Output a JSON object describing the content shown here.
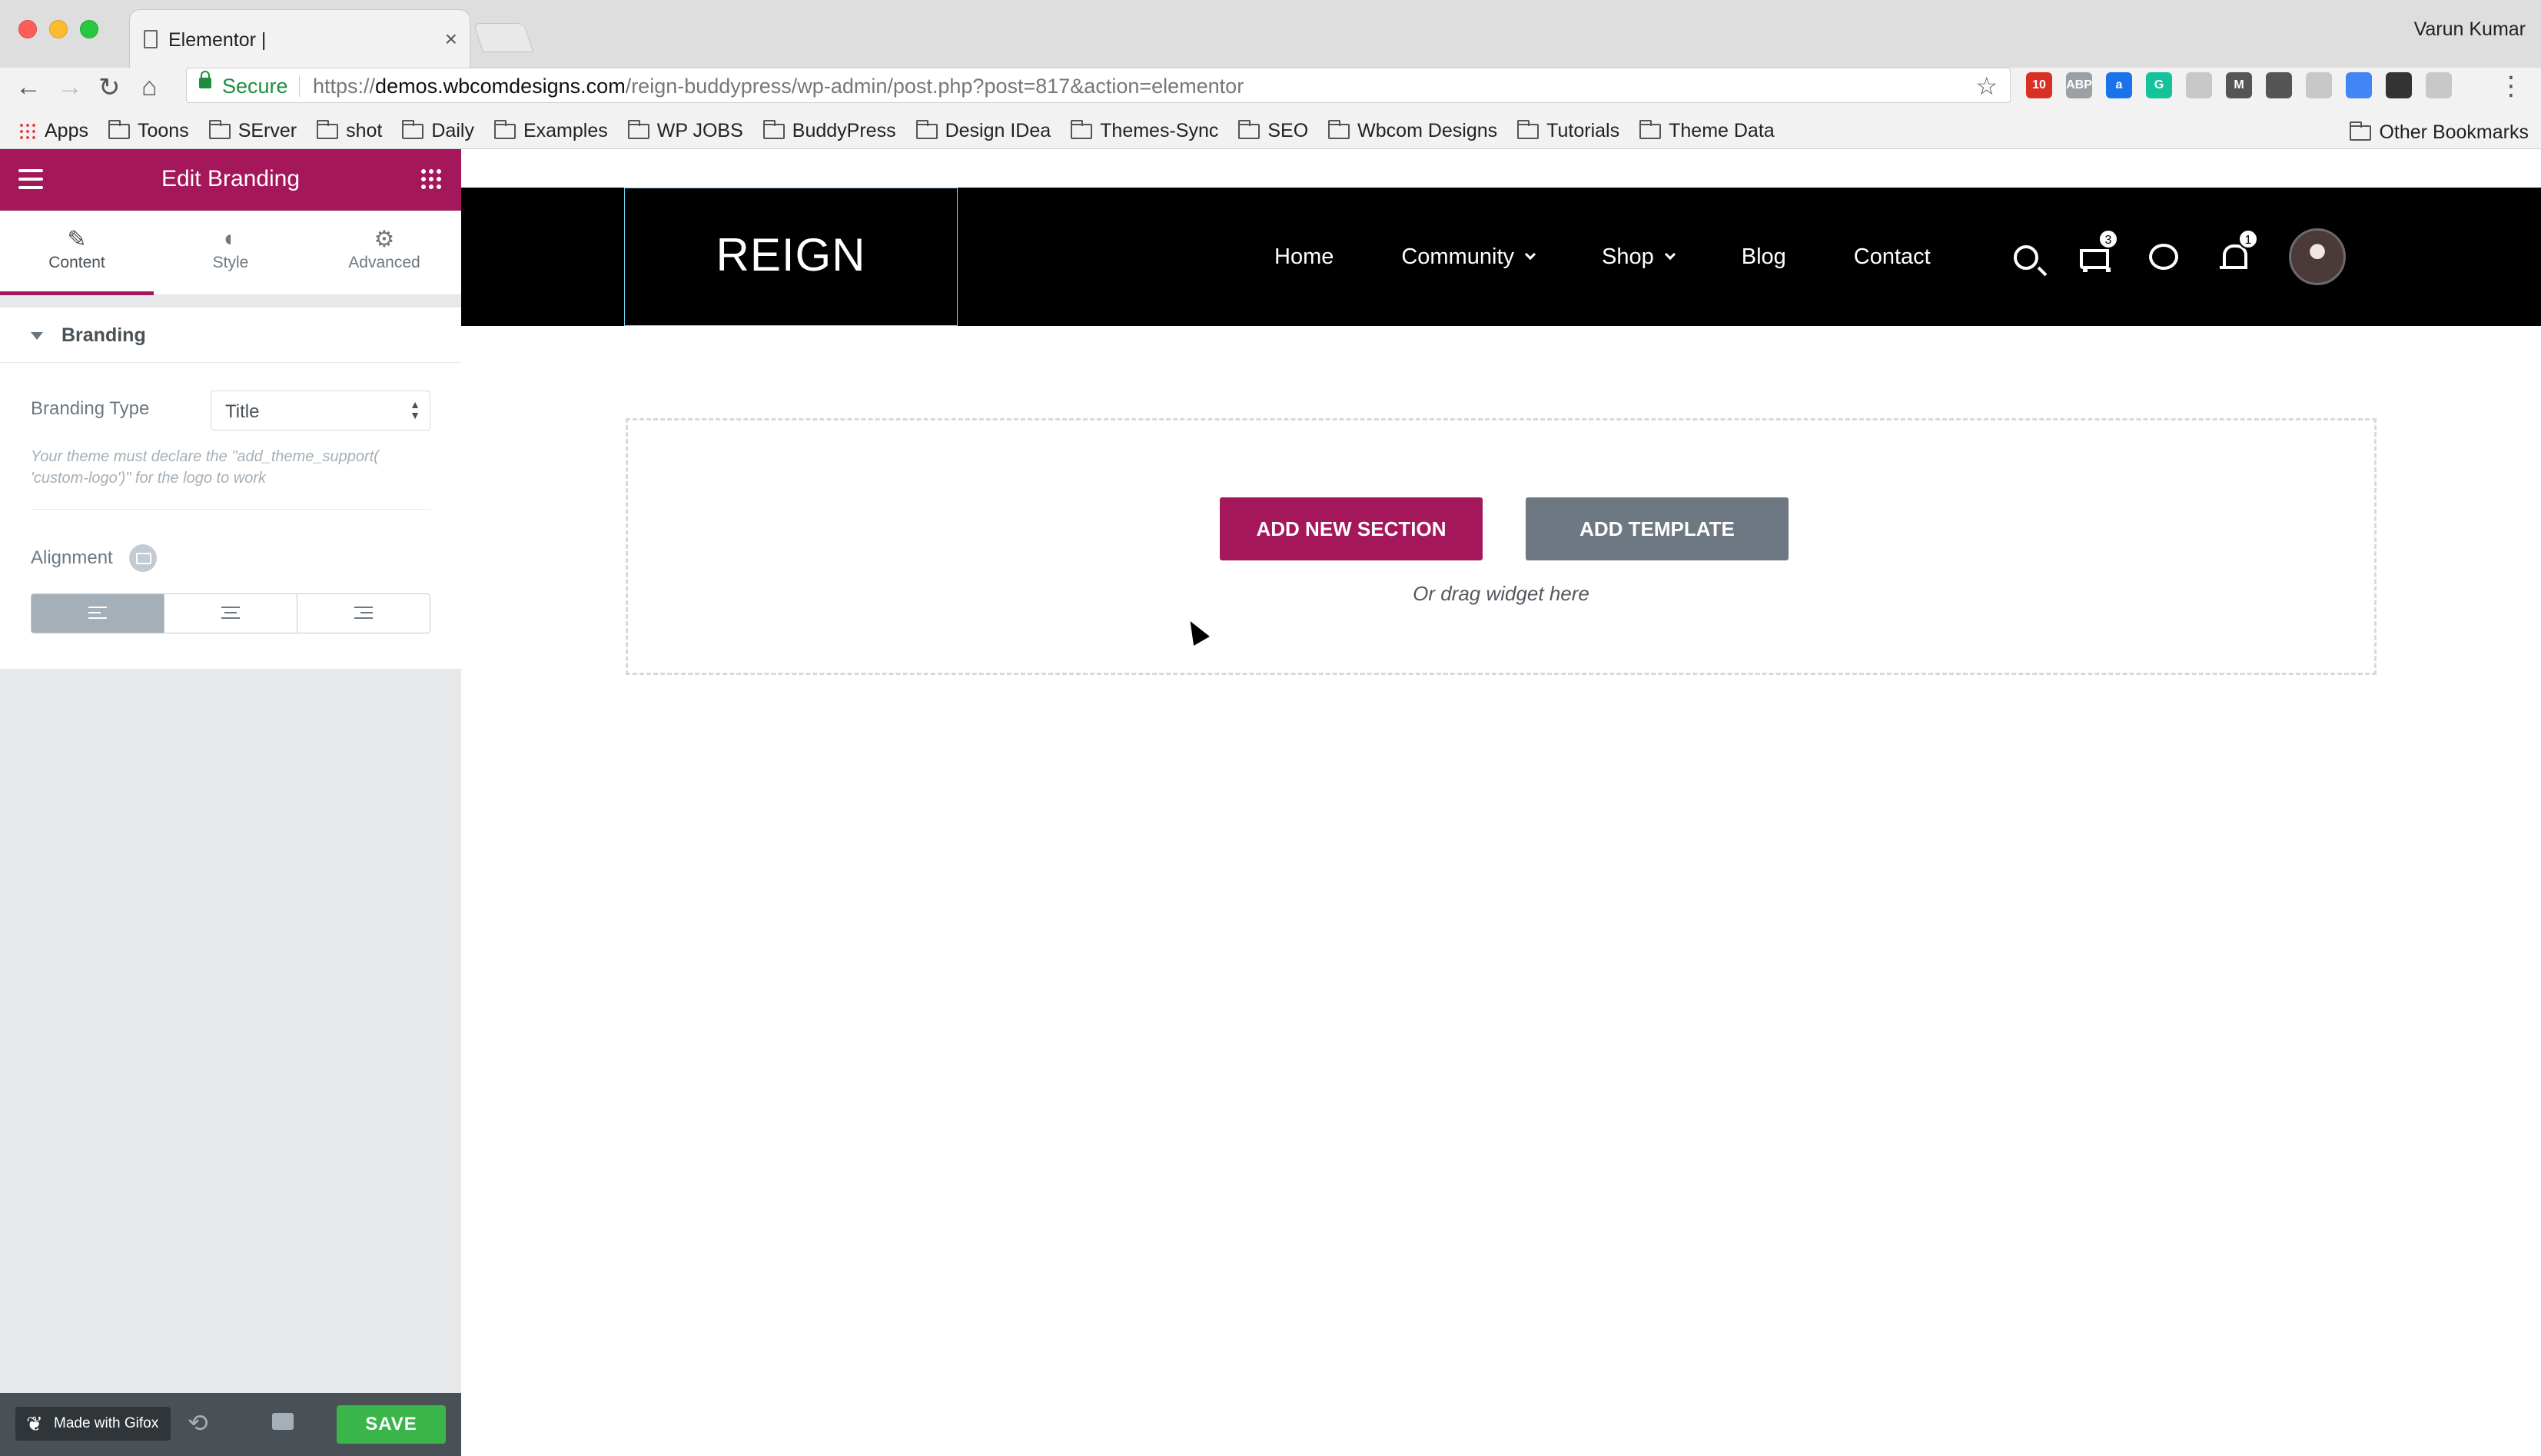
{
  "browser": {
    "tab_title": "Elementor |",
    "tab_close": "×",
    "user_name": "Varun Kumar",
    "secure_label": "Secure",
    "url_scheme": "https://",
    "url_host": "demos.wbcomdesigns.com",
    "url_path": "/reign-buddypress/wp-admin/post.php?post=817&action=elementor",
    "nav": {
      "back": "←",
      "forward": "→",
      "reload": "↻",
      "home": "⌂",
      "star": "☆",
      "menu": "⋮"
    },
    "extensions": [
      {
        "icon": "calendar-icon",
        "label": "10",
        "color": "#d93025"
      },
      {
        "icon": "adblock-icon",
        "label": "ABP",
        "color": "#9aa0a6"
      },
      {
        "icon": "a-icon",
        "label": "a",
        "color": "#1a73e8"
      },
      {
        "icon": "grammarly-icon",
        "label": "G",
        "color": "#15c39a"
      },
      {
        "icon": "rss-icon",
        "label": "",
        "color": "#c8c8c8"
      },
      {
        "icon": "m-icon",
        "label": "M",
        "color": "#555555"
      },
      {
        "icon": "evernote-icon",
        "label": "",
        "color": "#555555"
      },
      {
        "icon": "cloud-icon",
        "label": "",
        "color": "#c8c8c8"
      },
      {
        "icon": "translate-icon",
        "label": "",
        "color": "#4285f4"
      },
      {
        "icon": "camera-icon",
        "label": "",
        "color": "#333333"
      },
      {
        "icon": "moon-icon",
        "label": "",
        "color": "#c8c8c8"
      }
    ],
    "bookmarks": [
      {
        "type": "apps",
        "label": "Apps"
      },
      {
        "type": "folder",
        "label": "Toons"
      },
      {
        "type": "folder",
        "label": "SErver"
      },
      {
        "type": "folder",
        "label": "shot"
      },
      {
        "type": "folder",
        "label": "Daily"
      },
      {
        "type": "folder",
        "label": "Examples"
      },
      {
        "type": "folder",
        "label": "WP JOBS"
      },
      {
        "type": "folder",
        "label": "BuddyPress"
      },
      {
        "type": "folder",
        "label": "Design IDea"
      },
      {
        "type": "folder",
        "label": "Themes-Sync"
      },
      {
        "type": "folder",
        "label": "SEO"
      },
      {
        "type": "folder",
        "label": "Wbcom Designs"
      },
      {
        "type": "folder",
        "label": "Tutorials"
      },
      {
        "type": "folder",
        "label": "Theme Data"
      }
    ],
    "other_bookmarks": "Other Bookmarks"
  },
  "panel": {
    "title": "Edit Branding",
    "accent": "#a4175b",
    "tabs": [
      {
        "icon": "pencil-icon",
        "glyph": "✎",
        "label": "Content",
        "active": true
      },
      {
        "icon": "contrast-icon",
        "glyph": "◐",
        "label": "Style",
        "active": false
      },
      {
        "icon": "gear-icon",
        "glyph": "⚙",
        "label": "Advanced",
        "active": false
      }
    ],
    "section_title": "Branding",
    "branding_type_label": "Branding Type",
    "branding_type_value": "Title",
    "note": "Your theme must declare the \"add_theme_support( 'custom-logo')\" for the logo to work",
    "alignment_label": "Alignment",
    "alignment_options": [
      "left",
      "center",
      "right"
    ],
    "alignment_selected": "left",
    "footer": {
      "gifox_label": "Made with Gifox",
      "history_glyph": "⟲",
      "save_label": "SAVE",
      "collapse_glyph": "‹"
    }
  },
  "site": {
    "logo": "REIGN",
    "nav": [
      {
        "label": "Home",
        "dropdown": false
      },
      {
        "label": "Community",
        "dropdown": true
      },
      {
        "label": "Shop",
        "dropdown": true
      },
      {
        "label": "Blog",
        "dropdown": false
      },
      {
        "label": "Contact",
        "dropdown": false
      }
    ],
    "cart_count": "3",
    "notification_count": "1"
  },
  "canvas": {
    "add_section_label": "ADD NEW SECTION",
    "add_template_label": "ADD TEMPLATE",
    "drag_hint": "Or drag widget here"
  }
}
